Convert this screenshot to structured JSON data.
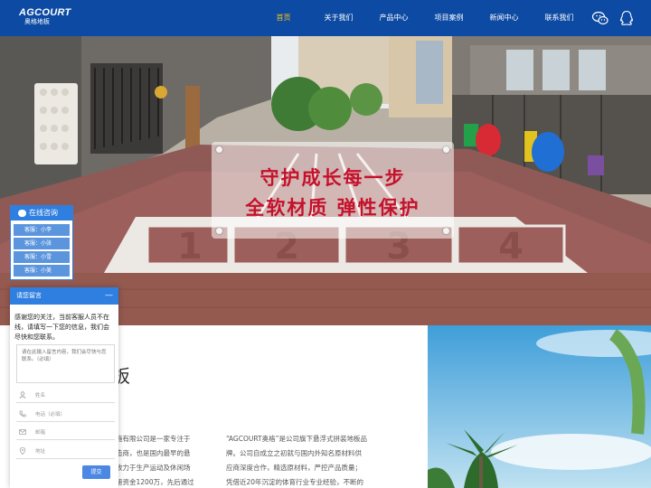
{
  "header": {
    "logo_main": "AGCOURT",
    "logo_sub": "奥格地板",
    "nav": [
      "首页",
      "关于我们",
      "产品中心",
      "项目案例",
      "新闻中心",
      "联系我们"
    ],
    "active_index": 0,
    "icons": [
      "wechat-icon",
      "qq-icon"
    ]
  },
  "banner": {
    "line1": "守护成长每一步",
    "line2": "全软材质  弹性保护",
    "court_numbers": [
      "1",
      "2",
      "3",
      "4"
    ],
    "slide_count": 4,
    "active_slide": 1
  },
  "about": {
    "title_fragment": "板",
    "left_lines": [
      "施有限公司是一家专注于",
      "造商，也是国内最早的悬",
      "致力于生产运动及休闲场",
      "册资金1200万，先后通过"
    ],
    "right_lines": [
      "“AGCOURT奥格”是公司旗下悬浮式拼装地板品",
      "牌。公司自成立之初就与国内外知名原材料供",
      "应商深度合作，精选原材料，严控产品质量；",
      "凭借近20年沉淀的体育行业专业经验，不断的"
    ]
  },
  "consult": {
    "title": "在线咨询",
    "items": [
      "客服：小李",
      "客服：小张",
      "客服：小雪",
      "客服：小美"
    ]
  },
  "message": {
    "title": "请您留言",
    "minimize": "—",
    "intro": "感谢您的关注，当前客服人员不在线，请填写一下您的信息，我们会尽快和您联系。",
    "textarea_placeholder": "请在此输入留言内容，我们会尽快与您联系。（必填）",
    "fields": [
      {
        "icon": "person-icon",
        "placeholder": "姓名"
      },
      {
        "icon": "phone-icon",
        "placeholder": "电话（必填）"
      },
      {
        "icon": "mail-icon",
        "placeholder": "邮箱"
      },
      {
        "icon": "location-icon",
        "placeholder": "地址"
      }
    ],
    "submit": "提交"
  },
  "colors": {
    "header": "#0d4aa3",
    "accent": "#f5c518",
    "caption": "#c5112b",
    "chat": "#2f7fe0"
  }
}
